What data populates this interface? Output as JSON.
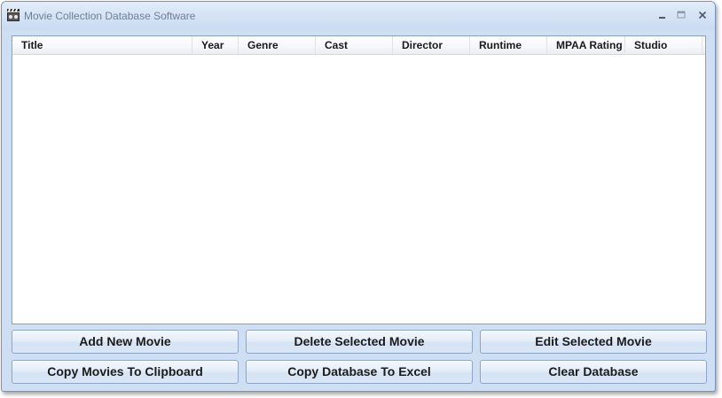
{
  "window": {
    "title": "Movie Collection Database Software",
    "icon": "film-clapper-icon"
  },
  "title_bar_controls": {
    "minimize_icon": "minimize-icon",
    "maximize_icon": "maximize-icon",
    "close_icon": "close-icon"
  },
  "listview": {
    "columns": [
      "Title",
      "Year",
      "Genre",
      "Cast",
      "Director",
      "Runtime",
      "MPAA Rating",
      "Studio"
    ],
    "rows": []
  },
  "buttons": {
    "add_new_movie": "Add New Movie",
    "delete_selected_movie": "Delete Selected Movie",
    "edit_selected_movie": "Edit Selected Movie",
    "copy_movies_to_clipboard": "Copy Movies To Clipboard",
    "copy_database_to_excel": "Copy Database To Excel",
    "clear_database": "Clear Database"
  },
  "colors": {
    "window_background": "#cfdff3",
    "title_text": "#6f7f95",
    "button_border": "#8ea6c6"
  }
}
